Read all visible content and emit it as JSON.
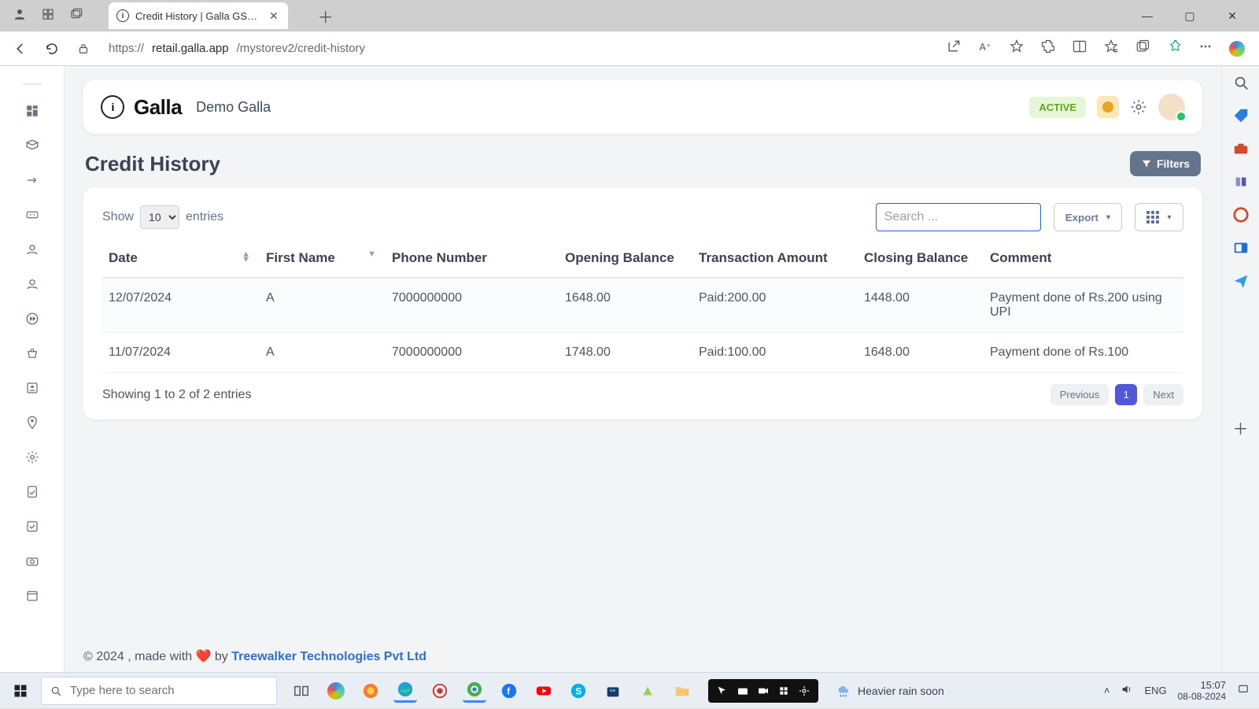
{
  "browser": {
    "tab_title": "Credit History | Galla GST - Inven",
    "url_display_prefix": "https://",
    "url_host": "retail.galla.app",
    "url_path": "/mystorev2/credit-history"
  },
  "app_header": {
    "logo_text": "Galla",
    "store_name": "Demo Galla",
    "status_badge": "ACTIVE"
  },
  "page": {
    "title": "Credit History",
    "filters_label": "Filters",
    "show_label": "Show",
    "entries_label": "entries",
    "page_size_value": "10",
    "search_placeholder": "Search ...",
    "export_label": "Export",
    "showing_text": "Showing 1 to 2 of 2 entries",
    "prev_label": "Previous",
    "next_label": "Next",
    "current_page": "1"
  },
  "table": {
    "columns": {
      "date": "Date",
      "first_name": "First Name",
      "phone": "Phone Number",
      "opening": "Opening Balance",
      "txn": "Transaction Amount",
      "closing": "Closing Balance",
      "comment": "Comment"
    },
    "rows": [
      {
        "date": "12/07/2024",
        "first_name": "A",
        "phone": "7000000000",
        "opening": "1648.00",
        "txn": "Paid:200.00",
        "closing": "1448.00",
        "comment": "Payment done of Rs.200 using UPI"
      },
      {
        "date": "11/07/2024",
        "first_name": "A",
        "phone": "7000000000",
        "opening": "1748.00",
        "txn": "Paid:100.00",
        "closing": "1648.00",
        "comment": "Payment done of Rs.100"
      }
    ]
  },
  "footer": {
    "prefix": "© 2024 , made with ",
    "heart": "❤️",
    "by": " by ",
    "company": "Treewalker Technologies Pvt Ltd"
  },
  "taskbar": {
    "search_placeholder": "Type here to search",
    "weather_text": "Heavier rain soon",
    "lang": "ENG",
    "time": "15:07",
    "date": "08-08-2024"
  }
}
